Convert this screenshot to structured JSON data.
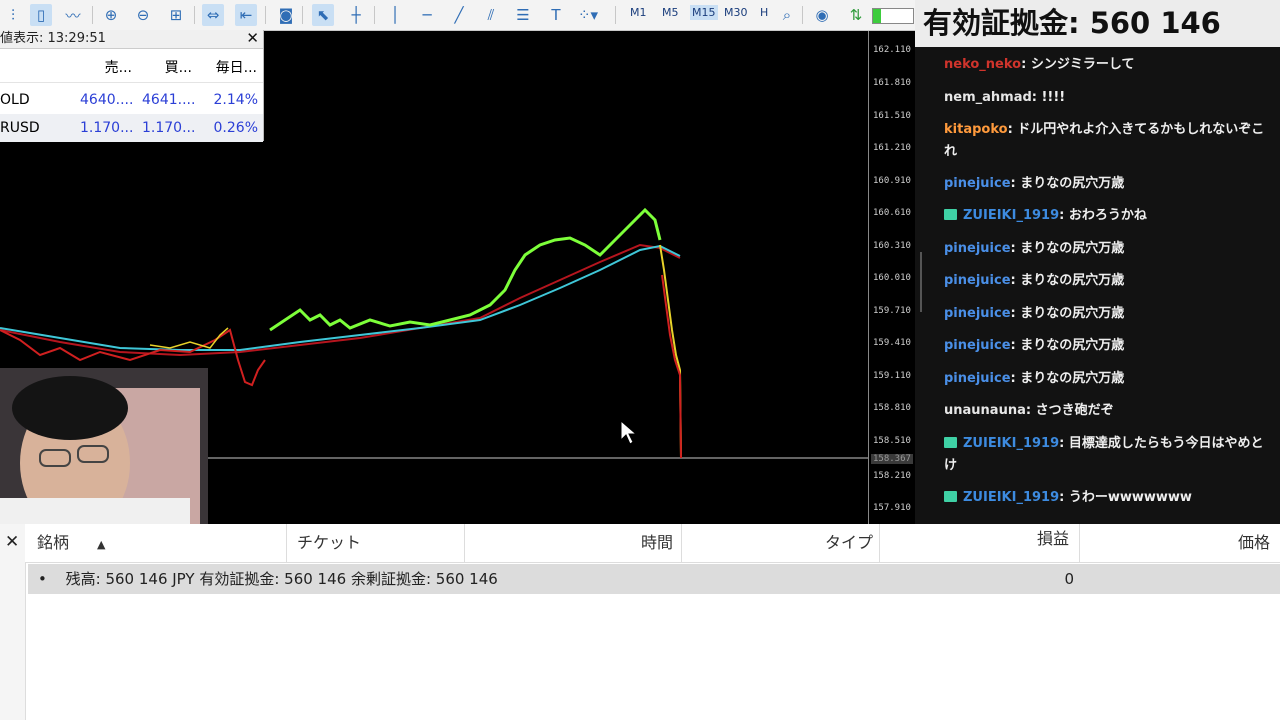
{
  "toolbar": {
    "timeframes": [
      "M1",
      "M5",
      "M15",
      "M30",
      "H"
    ],
    "active_timeframe": "M15"
  },
  "account_banner": "有効証拠金: 560 146",
  "market_watch": {
    "title": "値表示: 13:29:51",
    "columns": [
      "売...",
      "買...",
      "毎日..."
    ],
    "rows": [
      {
        "symbol": "OLD",
        "bid": "4640....",
        "ask": "4641....",
        "change": "2.14%"
      },
      {
        "symbol": "RUSD",
        "bid": "1.170....",
        "ask": "1.170....",
        "change": "0.26%"
      }
    ]
  },
  "price_axis": {
    "ticks": [
      "162.110",
      "161.810",
      "161.510",
      "161.210",
      "160.910",
      "160.610",
      "160.310",
      "160.010",
      "159.710",
      "159.410",
      "159.110",
      "158.810",
      "158.510",
      "158.210",
      "157.910"
    ],
    "current_price": "158.367"
  },
  "chat": {
    "messages": [
      {
        "user": "neko_neko",
        "badge": false,
        "color": "#d0342c",
        "text": ": シンジミラーして"
      },
      {
        "user": "nem_ahmad",
        "badge": false,
        "color": "#e6e6e6",
        "text": ": !!!!"
      },
      {
        "user": "kitapoko",
        "badge": false,
        "color": "#ff9a3c",
        "text": ": ドル円やれよ介入きてるかもしれないぞこれ"
      },
      {
        "user": "pinejuice",
        "badge": false,
        "color": "#4a8fe7",
        "text": ": まりなの尻穴万歳"
      },
      {
        "user": "ZUIEIKI_1919",
        "badge": true,
        "color": "#3d8be0",
        "text": ": おわろうかね"
      },
      {
        "user": "pinejuice",
        "badge": false,
        "color": "#4a8fe7",
        "text": ": まりなの尻穴万歳"
      },
      {
        "user": "pinejuice",
        "badge": false,
        "color": "#4a8fe7",
        "text": ": まりなの尻穴万歳"
      },
      {
        "user": "pinejuice",
        "badge": false,
        "color": "#4a8fe7",
        "text": ": まりなの尻穴万歳"
      },
      {
        "user": "pinejuice",
        "badge": false,
        "color": "#4a8fe7",
        "text": ": まりなの尻穴万歳"
      },
      {
        "user": "pinejuice",
        "badge": false,
        "color": "#4a8fe7",
        "text": ": まりなの尻穴万歳"
      },
      {
        "user": "unaunauna",
        "badge": false,
        "color": "#e6e6e6",
        "text": ": さつき砲だぞ"
      },
      {
        "user": "ZUIEIKI_1919",
        "badge": true,
        "color": "#3d8be0",
        "text": ": 目標達成したらもう今日はやめとけ"
      },
      {
        "user": "ZUIEIKI_1919",
        "badge": true,
        "color": "#3d8be0",
        "text": ": うわーwwwwwww"
      }
    ]
  },
  "terminal": {
    "columns": [
      "銘柄",
      "チケット",
      "時間",
      "タイプ",
      "損益",
      "価格"
    ],
    "summary": "残高: 560 146 JPY  有効証拠金: 560 146  余剰証拠金: 560 146",
    "profit": "0"
  }
}
